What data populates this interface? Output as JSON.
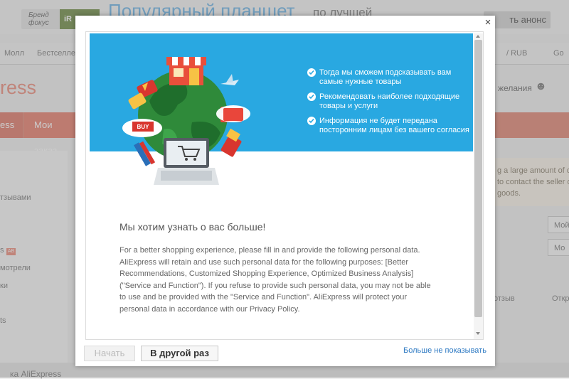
{
  "background": {
    "banner": {
      "brand_line1": "Бренд",
      "brand_line2": "фокус",
      "brand2": "iR",
      "promo_big": "Популярный планшет",
      "promo_small": "по лучшей",
      "anons_button": "ть анонс"
    },
    "nav": {
      "mall": "Молл",
      "bestsellers": "Бестселлер",
      "currency": "/ RUB",
      "go": "Go"
    },
    "logo_text": "ress",
    "wishlist": "и желания",
    "tabs": {
      "tab1": "ess",
      "tab2": "Мои заказ"
    },
    "left_items": [
      "тзывами",
      "s",
      "AB",
      "мотрели",
      "ки",
      "ts"
    ],
    "right_info": [
      "g a large amount of o",
      "to contact the seller d",
      "goods."
    ],
    "right_inputs": [
      "Мой",
      "Мо"
    ],
    "right_review": "отзыв",
    "right_otk": "Откр",
    "bottom_text": "ка AliExpress"
  },
  "modal": {
    "hero_points": [
      "Тогда мы сможем подсказывать вам самые нужные товары",
      "Рекомендовать наиболее подходящие товары и услуги",
      "Информация не будет передана посторонним лицам без вашего согласия"
    ],
    "buy_label": "BUY",
    "title": "Мы хотим узнать о вас больше!",
    "body": "For a better shopping experience, please fill in and provide the following personal data. AliExpress will retain and use such personal data for the following purposes: [Better Recommendations, Customized Shopping Experience, Optimized Business Analysis] (\"Service and Function\"). If you refuse to provide such personal data, you may not be able to use and be provided with the \"Service and Function\". AliExpress will protect your personal data in accordance with our Privacy Policy.",
    "start_button": "Начать",
    "later_button": "В другой раз",
    "dont_show_link": "Больше не показывать",
    "close_symbol": "×"
  },
  "colors": {
    "hero_blue": "#29a8e1",
    "brand_red": "#e8a093",
    "link_blue": "#2b78c2"
  }
}
